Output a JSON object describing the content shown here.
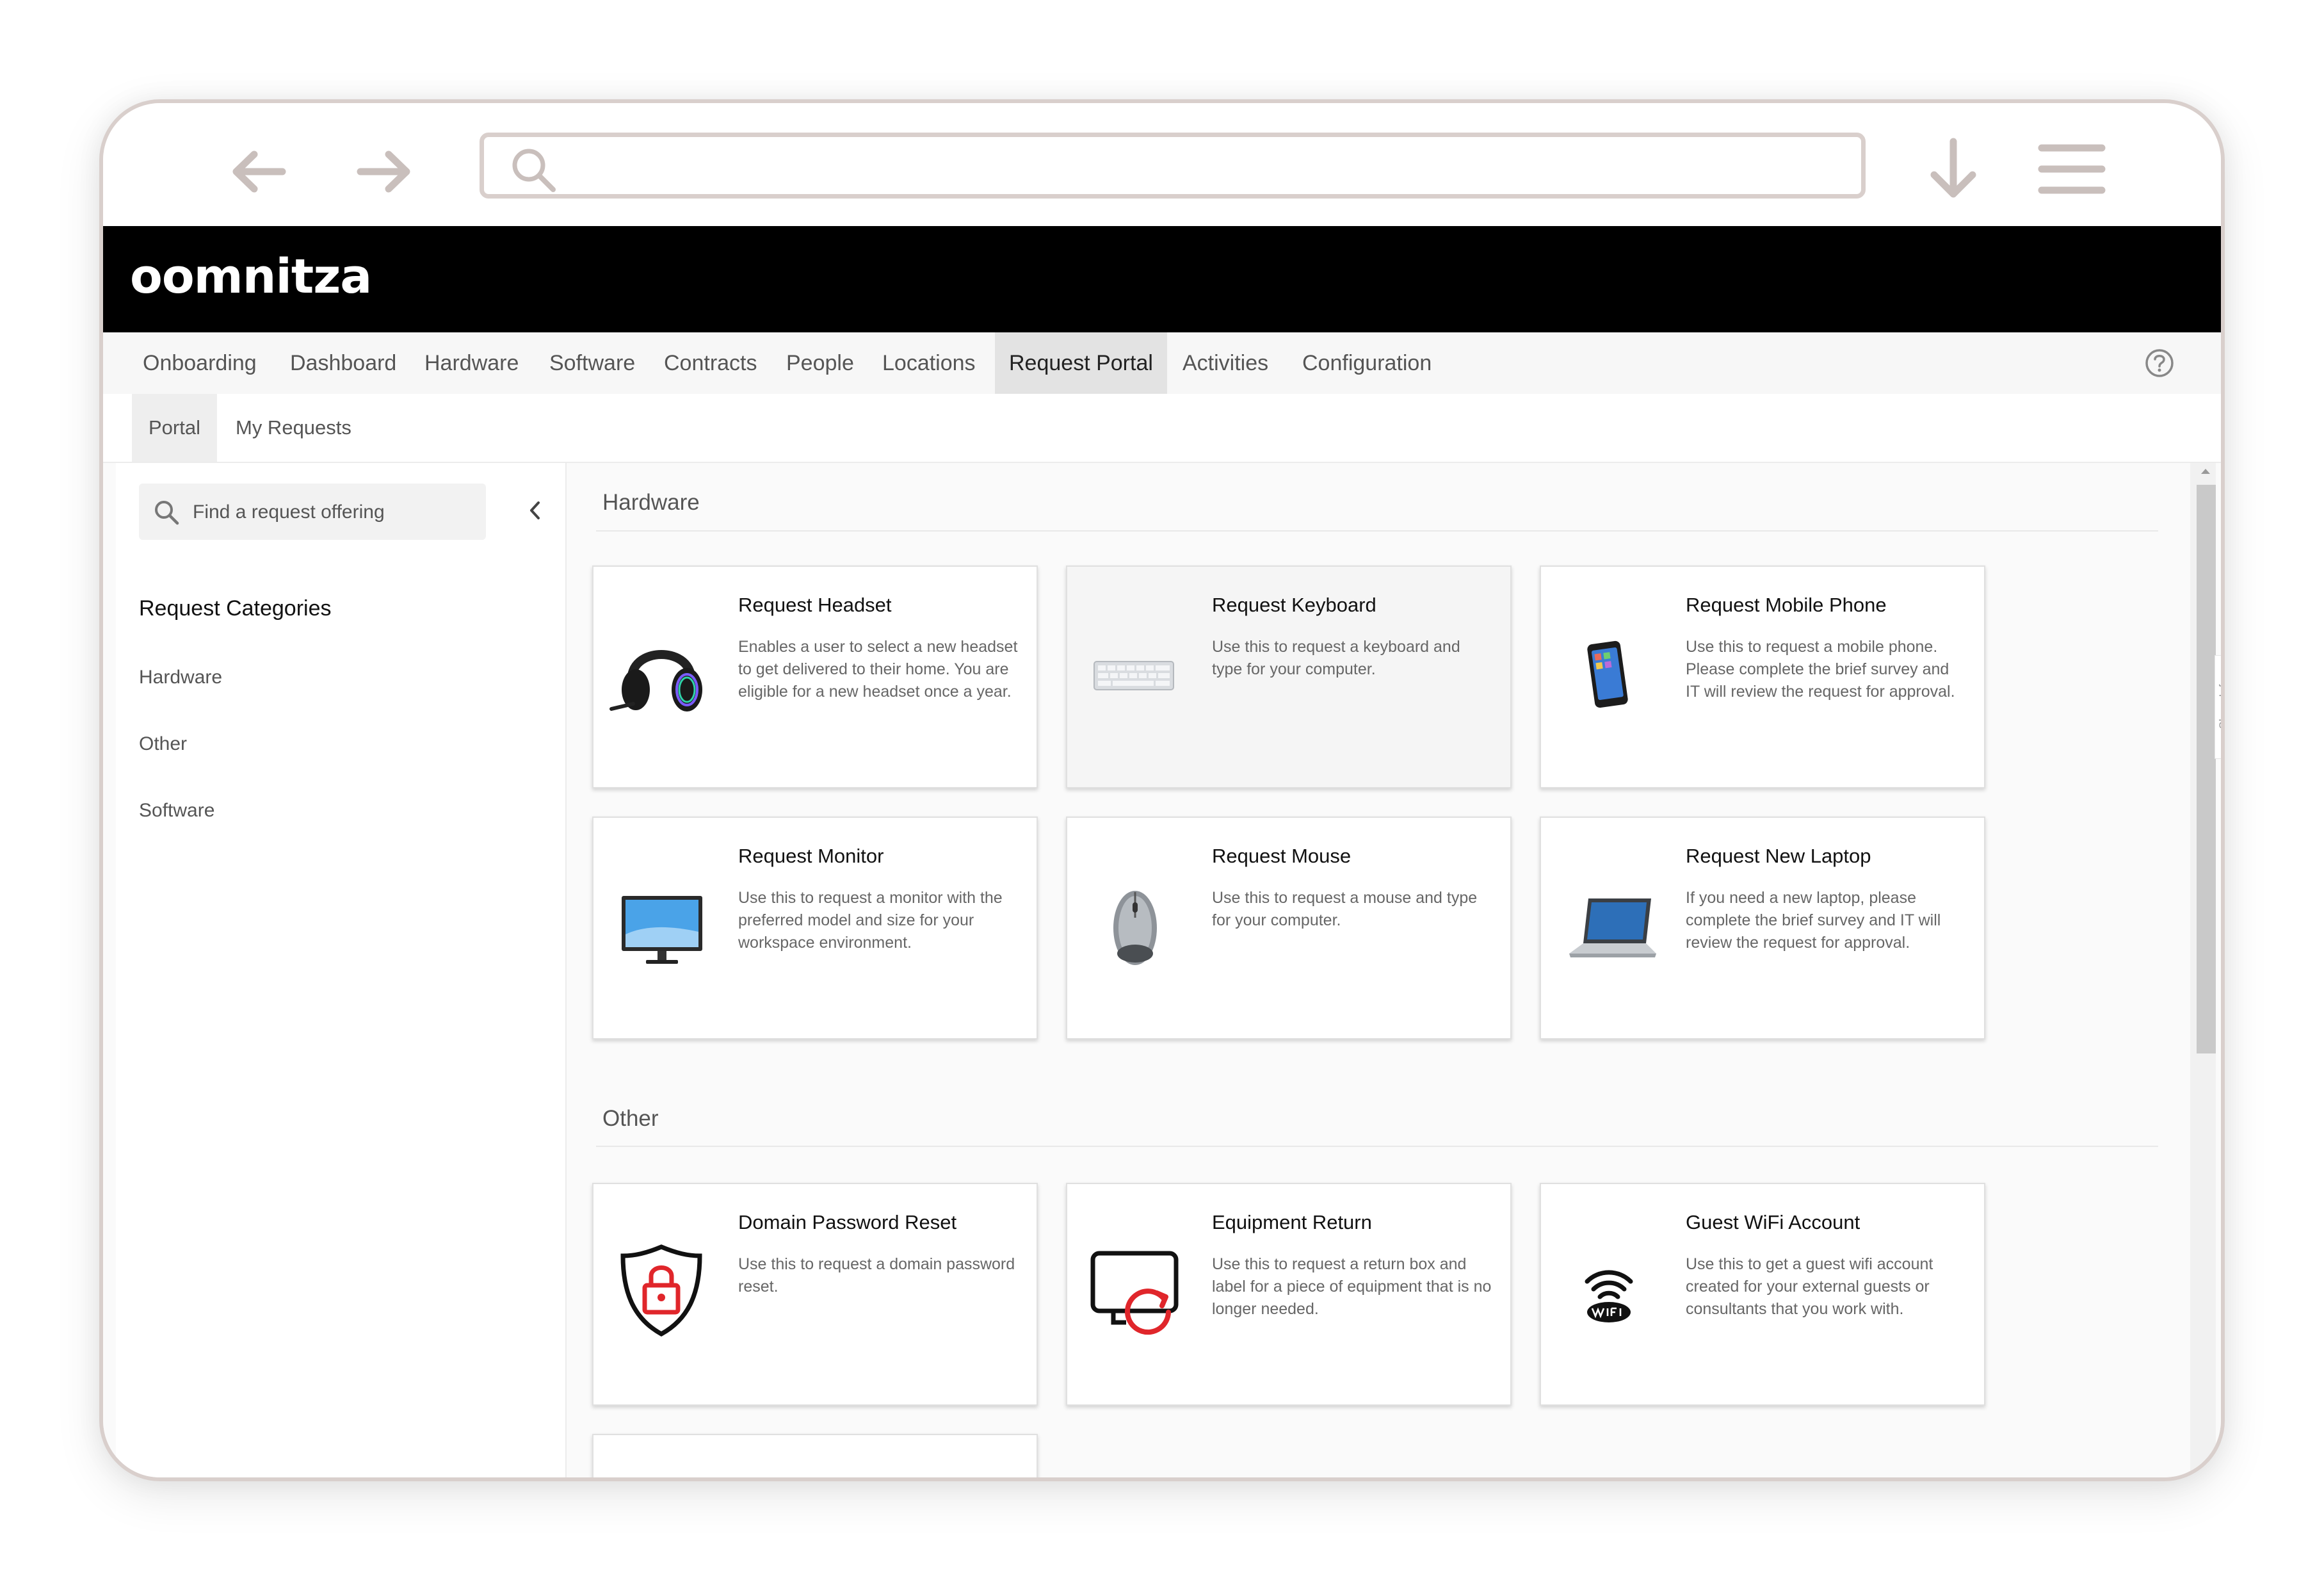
{
  "browser": {
    "back_icon": "arrow-left-icon",
    "forward_icon": "arrow-right-icon",
    "search_icon": "search-icon",
    "download_icon": "download-icon",
    "menu_icon": "hamburger-menu-icon",
    "chrome_color": "#d9cfcc"
  },
  "brand": {
    "logo_text": "oomnitza"
  },
  "main_nav": {
    "items": [
      "Onboarding",
      "Dashboard",
      "Hardware",
      "Software",
      "Contracts",
      "People",
      "Locations",
      "Request Portal",
      "Activities",
      "Configuration"
    ],
    "active": "Request Portal",
    "help_icon": "help-circle-icon"
  },
  "sub_nav": {
    "tabs": [
      "Portal",
      "My Requests"
    ],
    "active": "Portal"
  },
  "sidebar": {
    "search_placeholder": "Find a request offering",
    "collapse_icon": "chevron-left-icon",
    "categories_title": "Request Categories",
    "categories": [
      "Hardware",
      "Other",
      "Software"
    ]
  },
  "sections": [
    {
      "title": "Hardware",
      "cards": [
        {
          "title": "Request Headset",
          "desc": "Enables a user to select a new headset to get delivered to their home. You are eligible for a new headset once a year.",
          "icon": "headset-icon"
        },
        {
          "title": "Request Keyboard",
          "desc": "Use this to request a keyboard and type for your computer.",
          "icon": "keyboard-icon"
        },
        {
          "title": "Request Mobile Phone",
          "desc": "Use this to request a mobile phone. Please complete the brief survey and IT will review the request for approval.",
          "icon": "mobile-phone-icon"
        },
        {
          "title": "Request Monitor",
          "desc": "Use this to request a monitor with the preferred model and size for your workspace environment.",
          "icon": "monitor-icon"
        },
        {
          "title": "Request Mouse",
          "desc": "Use this to request a mouse and type for your computer.",
          "icon": "mouse-icon"
        },
        {
          "title": "Request New Laptop",
          "desc": "If you need a new laptop, please complete the brief survey and IT will review the request for approval.",
          "icon": "laptop-icon"
        }
      ]
    },
    {
      "title": "Other",
      "cards": [
        {
          "title": "Domain Password Reset",
          "desc": "Use this to request a domain password reset.",
          "icon": "shield-lock-icon"
        },
        {
          "title": "Equipment Return",
          "desc": "Use this to request a return box and label for a piece of equipment that is no longer needed.",
          "icon": "equipment-return-icon"
        },
        {
          "title": "Guest WiFi Account",
          "desc": "Use this to get a guest wifi account created for your external guests or consultants that you work with.",
          "icon": "wifi-icon"
        }
      ]
    }
  ],
  "side_panel": {
    "label": "Show Info"
  },
  "colors": {
    "brand_bar": "#000000",
    "accent_red": "#e0262b",
    "active_tab": "#e3e3e3"
  }
}
